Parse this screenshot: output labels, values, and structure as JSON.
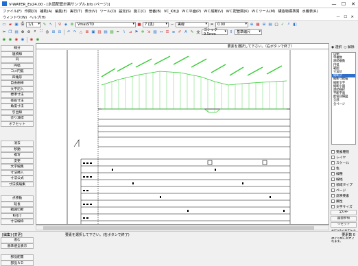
{
  "window": {
    "title": "V-WATER_Ex24.00 - [水道配管計画サンプル.bfo (ページ)]",
    "min": "—",
    "max": "☐",
    "close": "✕"
  },
  "menu": [
    "ファイル(F)",
    "作図(D)",
    "補助(A)",
    "編集(E)",
    "実行(T)",
    "表示(V)",
    "ツール(O)",
    "設定(S)",
    "施工(C)",
    "管番(B)",
    "VC_Kit(J)",
    "ＷＣ平面(P)",
    "ＷＣ縦断(V)",
    "ＷＣ配管図(K)",
    "ＷＣツール(M)",
    "構造物標準図",
    "水養表(R)"
  ],
  "menu2": [
    "ウィンドウ(W)",
    "ヘルプ(H)"
  ],
  "mdi_buttons": "— ☐ ✕",
  "toolbar": {
    "page": "1/1",
    "layer_combo": "VmasSTD",
    "pen_combo": "7 (黒)",
    "line_combo": "実線",
    "width_combo": "0.00",
    "font_combo": "ゴシック9.5mm",
    "scale_combo": "基準縮尺"
  },
  "left_buttons": {
    "group1": [
      "線分",
      "連続線",
      "円",
      "円弧",
      "コメ円弧",
      "四角形",
      "自由曲線",
      "文字記入",
      "標準寸法",
      "径長寸法",
      "角度寸法",
      "引出線",
      "塗り潰標",
      "オフセット"
    ],
    "group2": [
      "消去",
      "移動",
      "複写",
      "変更",
      "文字編集",
      "寸法挿入",
      "寸法公式",
      "寸法枝編集"
    ],
    "group3": [
      "点移動",
      "延長",
      "範囲切断",
      "R付け",
      "寸法線枠"
    ],
    "group4": [
      "戻る",
      "進む",
      "基準値全表示"
    ],
    "group5": [
      "部品配置",
      "部品ＡＤ"
    ]
  },
  "canvas": {
    "prompt": "要素を選択して下さい。（右ボタンで終了）",
    "center_mark": "▯"
  },
  "right_panel": {
    "radio_select": "選択",
    "radio_release": "解除",
    "layers": [
      "自動",
      "単複数",
      "連続複数",
      "円弧",
      "範囲",
      "寸法計",
      "縦断計",
      "縦断寸絵描",
      "縦断文字",
      "縦断小図",
      "連続線枠",
      "平断平面",
      "配管詳細図",
      "全部",
      "全ページ"
    ],
    "selected_index": 6,
    "checks": [
      "要素種別",
      "レイヤ",
      "スケール",
      "色",
      "線種",
      "線幅",
      "領域タイプ",
      "ページ",
      "反映要素",
      "属性",
      "文字サイズ"
    ],
    "buttons": [
      "全OFF",
      "図面参照",
      "リセット"
    ],
    "note": "※[Ctrl]+[ALT]+左ボタンでレイヤ分類が可能に変更されます。"
  },
  "status": {
    "left": "[編集]-[変更]",
    "center": "要素を選択して下さい。(右ボタンで終了)",
    "right": "要素数 0"
  },
  "colors": {
    "profile_green": "#33cc33",
    "line_black": "#000000",
    "selection": "#2f6ec9"
  }
}
